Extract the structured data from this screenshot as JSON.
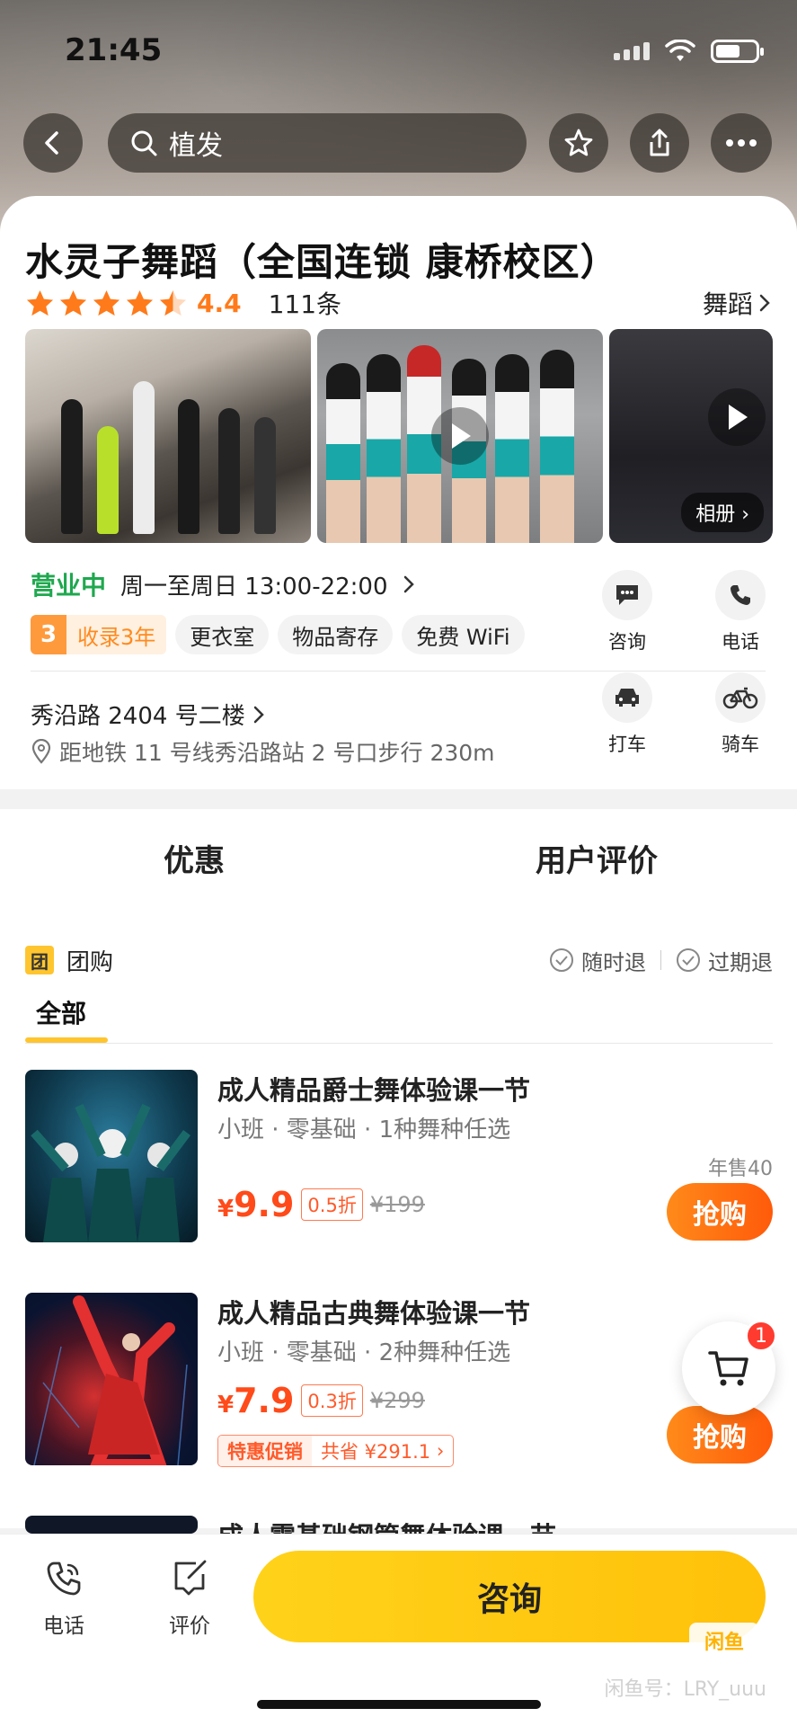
{
  "status": {
    "time": "21:45"
  },
  "nav": {
    "search_text": "植发"
  },
  "shop": {
    "title": "水灵子舞蹈（全国连锁 康桥校区）",
    "rating": "4.4",
    "review_count": "111条",
    "category": "舞蹈",
    "album_label": "相册",
    "open_status": "营业中",
    "hours": "周一至周日 13:00-22:00",
    "years_num": "3",
    "years_text": "收录3年",
    "tags": [
      "更衣室",
      "物品寄存",
      "免费 WiFi"
    ],
    "actions": {
      "consult": "咨询",
      "phone": "电话",
      "taxi": "打车",
      "bike": "骑车"
    },
    "address": "秀沿路 2404 号二楼",
    "metro": "距地铁 11 号线秀沿路站 2 号口步行 230m"
  },
  "tabs": {
    "deals": "优惠",
    "reviews": "用户评价"
  },
  "group": {
    "icon_text": "团",
    "label": "团购",
    "refund_any": "随时退",
    "refund_expired": "过期退",
    "sub_tab": "全部"
  },
  "items": [
    {
      "title": "成人精品爵士舞体验课一节",
      "sub": "小班 · 零基础 · 1种舞种任选",
      "currency": "¥",
      "price": "9.9",
      "discount": "0.5折",
      "original": "¥199",
      "sold": "年售40",
      "buy": "抢购"
    },
    {
      "title": "成人精品古典舞体验课一节",
      "sub": "小班 · 零基础 · 2种舞种任选",
      "currency": "¥",
      "price": "7.9",
      "discount": "0.3折",
      "original": "¥299",
      "promo_label": "特惠促销",
      "promo_text": "共省 ¥291.1",
      "buy": "抢购"
    },
    {
      "title": "成人零基础钢管舞体验课一节"
    }
  ],
  "cart": {
    "badge": "1"
  },
  "bottom": {
    "phone": "电话",
    "review": "评价",
    "consult": "咨询",
    "logo": "闲鱼",
    "watermark": "闲鱼号：LRY_uuu"
  },
  "colors": {
    "accent": "#ffc52f",
    "price": "#ff4a1a",
    "open": "#1fa84f",
    "rating": "#ff7a1a"
  }
}
